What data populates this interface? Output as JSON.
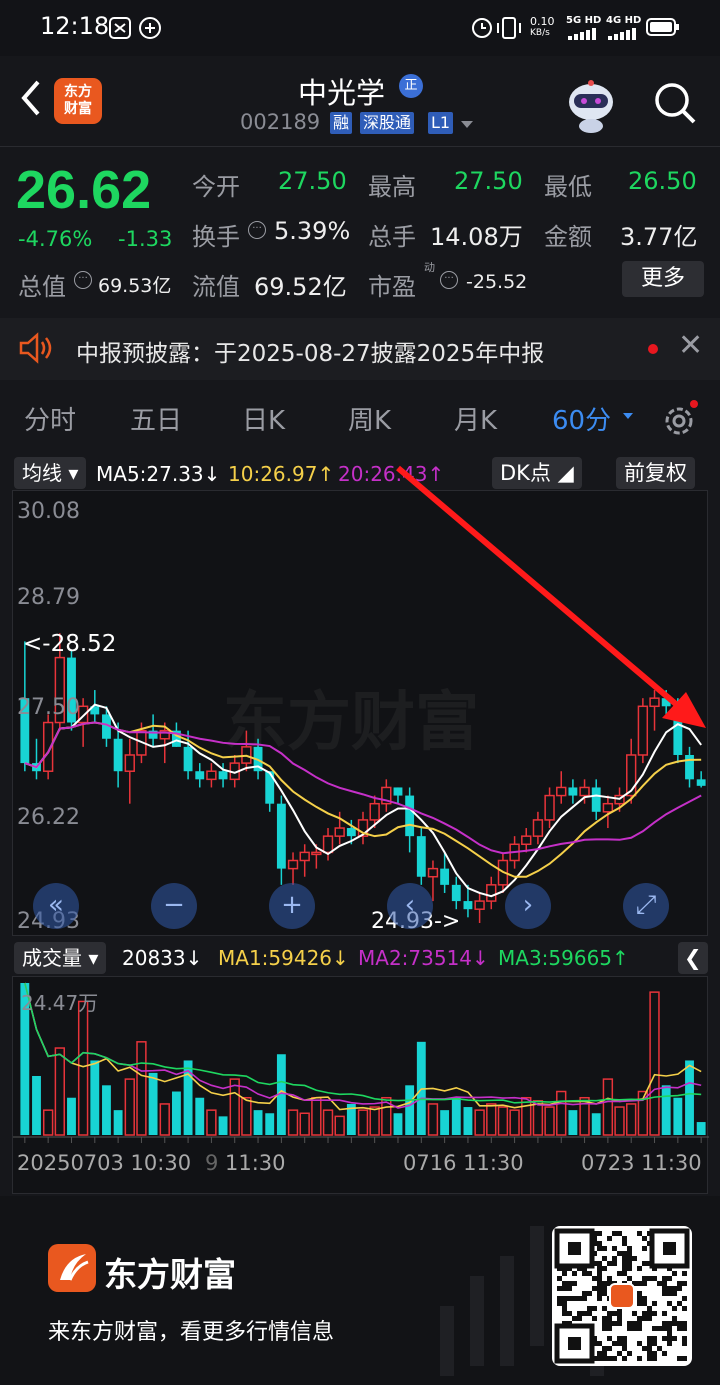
{
  "status_bar": {
    "time": "12:18",
    "net_speed": "0.10",
    "net_unit": "KB/s",
    "net1": "5G HD",
    "net2": "4G HD"
  },
  "header": {
    "name": "中光学",
    "badge": "正",
    "code": "002189",
    "tags": [
      "融",
      "深股通",
      "L1"
    ],
    "logo_text": "东方财富"
  },
  "quote": {
    "price": "26.62",
    "pct": "-4.76%",
    "chg": "-1.33",
    "fields": [
      {
        "label": "今开",
        "value": "27.50"
      },
      {
        "label": "最高",
        "value": "27.50"
      },
      {
        "label": "最低",
        "value": "26.50"
      },
      {
        "label": "换手",
        "value": "5.39%"
      },
      {
        "label": "总手",
        "value": "14.08万"
      },
      {
        "label": "金额",
        "value": "3.77亿"
      },
      {
        "label": "总值",
        "value": "69.53亿"
      },
      {
        "label": "流值",
        "value": "69.52亿"
      },
      {
        "label": "市盈",
        "sup": "动",
        "value": "-25.52"
      }
    ],
    "more": "更多"
  },
  "notice": {
    "text": "中报预披露：于2025-08-27披露2025年中报"
  },
  "tabs": [
    "分时",
    "五日",
    "日K",
    "周K",
    "月K",
    "60分"
  ],
  "active_tab": "60分",
  "ma_bar": {
    "selector": "均线",
    "ma5": "MA5:27.33↓",
    "ma10": "10:26.97↑",
    "ma20": "20:26.43↑",
    "dk": "DK点",
    "adjust": "前复权"
  },
  "chart_data": {
    "type": "candlestick",
    "y_ticks": [
      "30.08",
      "28.79",
      "27.50",
      "26.22",
      "24.93"
    ],
    "ylim": [
      24.93,
      30.08
    ],
    "high_annotation": "<-28.52",
    "low_annotation": "24.93->",
    "x_ticks": [
      "20250703 10:30",
      "9",
      "11:30",
      "0716 11:30",
      "0723 11:30"
    ],
    "candles": [
      [
        27.7,
        28.4,
        26.8,
        26.9
      ],
      [
        26.9,
        27.2,
        26.7,
        26.8
      ],
      [
        26.8,
        27.5,
        26.7,
        27.4
      ],
      [
        27.4,
        28.5,
        27.3,
        28.2
      ],
      [
        28.2,
        28.3,
        27.3,
        27.4
      ],
      [
        27.4,
        27.7,
        27.1,
        27.6
      ],
      [
        27.6,
        27.8,
        27.4,
        27.5
      ],
      [
        27.5,
        27.6,
        27.1,
        27.2
      ],
      [
        27.2,
        27.4,
        26.6,
        26.8
      ],
      [
        26.8,
        27.2,
        26.4,
        27.0
      ],
      [
        27.0,
        27.4,
        26.9,
        27.3
      ],
      [
        27.3,
        27.5,
        27.1,
        27.2
      ],
      [
        27.2,
        27.4,
        26.9,
        27.3
      ],
      [
        27.3,
        27.4,
        27.1,
        27.1
      ],
      [
        27.1,
        27.3,
        26.7,
        26.8
      ],
      [
        26.8,
        26.9,
        26.6,
        26.7
      ],
      [
        26.7,
        26.9,
        26.6,
        26.8
      ],
      [
        26.8,
        26.9,
        26.6,
        26.7
      ],
      [
        26.7,
        27.0,
        26.6,
        26.9
      ],
      [
        26.9,
        27.3,
        26.8,
        27.1
      ],
      [
        27.1,
        27.2,
        26.7,
        26.8
      ],
      [
        26.8,
        26.8,
        26.3,
        26.4
      ],
      [
        26.4,
        26.5,
        25.4,
        25.6
      ],
      [
        25.6,
        25.8,
        25.4,
        25.7
      ],
      [
        25.7,
        25.9,
        25.5,
        25.8
      ],
      [
        25.8,
        25.9,
        25.6,
        25.8
      ],
      [
        25.8,
        26.1,
        25.7,
        26.0
      ],
      [
        26.0,
        26.3,
        25.9,
        26.1
      ],
      [
        26.1,
        26.2,
        25.9,
        26.0
      ],
      [
        26.0,
        26.3,
        25.9,
        26.2
      ],
      [
        26.2,
        26.5,
        26.1,
        26.4
      ],
      [
        26.4,
        26.7,
        26.3,
        26.6
      ],
      [
        26.6,
        26.6,
        26.4,
        26.5
      ],
      [
        26.5,
        26.6,
        25.8,
        26.0
      ],
      [
        26.0,
        26.1,
        25.4,
        25.5
      ],
      [
        25.5,
        25.7,
        25.2,
        25.6
      ],
      [
        25.6,
        25.8,
        25.3,
        25.4
      ],
      [
        25.4,
        25.5,
        25.1,
        25.2
      ],
      [
        25.2,
        25.4,
        25.0,
        25.1
      ],
      [
        25.1,
        25.3,
        24.93,
        25.2
      ],
      [
        25.2,
        25.5,
        25.1,
        25.4
      ],
      [
        25.4,
        25.8,
        25.3,
        25.7
      ],
      [
        25.7,
        26.0,
        25.6,
        25.9
      ],
      [
        25.9,
        26.1,
        25.8,
        26.0
      ],
      [
        26.0,
        26.3,
        25.9,
        26.2
      ],
      [
        26.2,
        26.6,
        26.1,
        26.5
      ],
      [
        26.5,
        26.8,
        26.4,
        26.6
      ],
      [
        26.6,
        26.7,
        26.4,
        26.5
      ],
      [
        26.5,
        26.7,
        26.4,
        26.6
      ],
      [
        26.6,
        26.7,
        26.2,
        26.3
      ],
      [
        26.3,
        26.5,
        26.1,
        26.4
      ],
      [
        26.4,
        26.6,
        26.3,
        26.5
      ],
      [
        26.5,
        27.2,
        26.4,
        27.0
      ],
      [
        27.0,
        27.7,
        26.9,
        27.6
      ],
      [
        27.6,
        27.8,
        27.3,
        27.7
      ],
      [
        27.7,
        27.8,
        27.5,
        27.6
      ],
      [
        27.6,
        27.7,
        26.9,
        27.0
      ],
      [
        27.0,
        27.1,
        26.6,
        26.7
      ],
      [
        26.7,
        26.8,
        26.6,
        26.62
      ]
    ],
    "ma5_color": "#ffffff",
    "ma10_color": "#f5d04a",
    "ma20_color": "#c530c8",
    "volume": {
      "header": {
        "selector": "成交量",
        "vol": "20833↓",
        "ma1": "MA1:59426↓",
        "ma2": "MA2:73514↓",
        "ma3": "MA3:59665↑"
      },
      "ymax_label": "24.47万",
      "ymax": 244700,
      "values": [
        244700,
        95000,
        40000,
        140000,
        60000,
        215000,
        120000,
        80000,
        40000,
        90000,
        150000,
        100000,
        50000,
        70000,
        120000,
        60000,
        40000,
        30000,
        90000,
        60000,
        40000,
        35000,
        130000,
        40000,
        35000,
        60000,
        40000,
        30000,
        50000,
        40000,
        45000,
        60000,
        35000,
        80000,
        150000,
        50000,
        40000,
        60000,
        45000,
        40000,
        50000,
        45000,
        40000,
        60000,
        55000,
        45000,
        70000,
        40000,
        60000,
        35000,
        90000,
        45000,
        50000,
        70000,
        230000,
        80000,
        60000,
        120000,
        20833
      ]
    }
  },
  "controls": {
    "left": "«",
    "minus": "−",
    "plus": "+",
    "prev": "‹",
    "next": "›",
    "expand": "⤢"
  },
  "watermark": "东方财富",
  "footer": {
    "brand": "东方财富",
    "slogan": "来东方财富，看更多行情信息"
  },
  "colors": {
    "up": "#e8343a",
    "down": "#18d4d4",
    "accent": "#3c8cf2",
    "price_green": "#1ed760"
  }
}
